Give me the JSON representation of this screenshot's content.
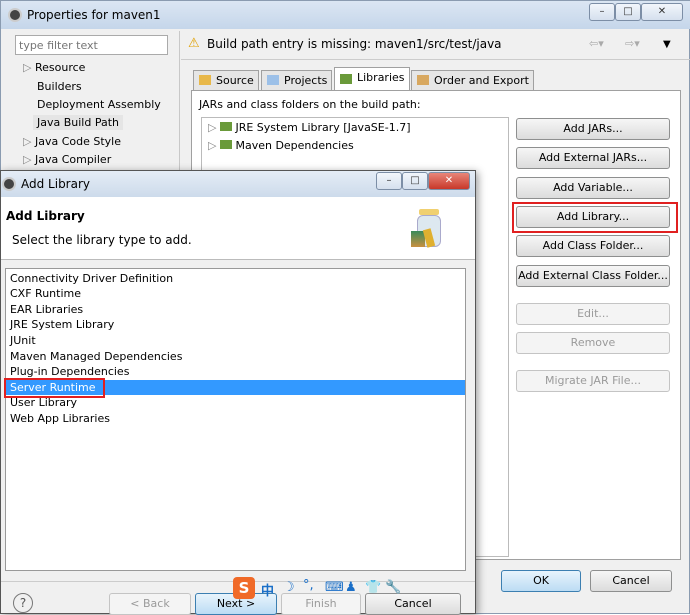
{
  "main_window": {
    "title": "Properties for maven1",
    "filter_placeholder": "type filter text",
    "nav_items": [
      {
        "label": "Resource",
        "expandable": true
      },
      {
        "label": "Builders",
        "expandable": false
      },
      {
        "label": "Deployment Assembly",
        "expandable": false
      },
      {
        "label": "Java Build Path",
        "expandable": false,
        "selected": true
      },
      {
        "label": "Java Code Style",
        "expandable": true
      },
      {
        "label": "Java Compiler",
        "expandable": true
      }
    ],
    "warning": "Build path entry is missing: maven1/src/test/java",
    "tabs": [
      {
        "label": "Source"
      },
      {
        "label": "Projects"
      },
      {
        "label": "Libraries",
        "active": true
      },
      {
        "label": "Order and Export"
      }
    ],
    "section_label": "JARs and class folders on the build path:",
    "entries": [
      "JRE System Library [JavaSE-1.7]",
      "Maven Dependencies"
    ],
    "buttons": [
      {
        "label": "Add JARs...",
        "enabled": true
      },
      {
        "label": "Add External JARs...",
        "enabled": true
      },
      {
        "label": "Add Variable...",
        "enabled": true
      },
      {
        "label": "Add Library...",
        "enabled": true,
        "highlighted": true
      },
      {
        "label": "Add Class Folder...",
        "enabled": true
      },
      {
        "label": "Add External Class Folder...",
        "enabled": true
      },
      {
        "label": "Edit...",
        "enabled": false
      },
      {
        "label": "Remove",
        "enabled": false
      },
      {
        "label": "Migrate JAR File...",
        "enabled": false
      }
    ],
    "ok": "OK",
    "cancel": "Cancel"
  },
  "dialog": {
    "window_title": "Add Library",
    "heading": "Add Library",
    "subtitle": "Select the library type to add.",
    "library_types": [
      "Connectivity Driver Definition",
      "CXF Runtime",
      "EAR Libraries",
      "JRE System Library",
      "JUnit",
      "Maven Managed Dependencies",
      "Plug-in Dependencies",
      "Server Runtime",
      "User Library",
      "Web App Libraries"
    ],
    "selected": "Server Runtime",
    "back": "< Back",
    "next": "Next >",
    "finish": "Finish",
    "cancel": "Cancel",
    "selection_color": "#3399ff"
  },
  "ime_toolbar": {
    "logo": "S",
    "mode": "中"
  }
}
